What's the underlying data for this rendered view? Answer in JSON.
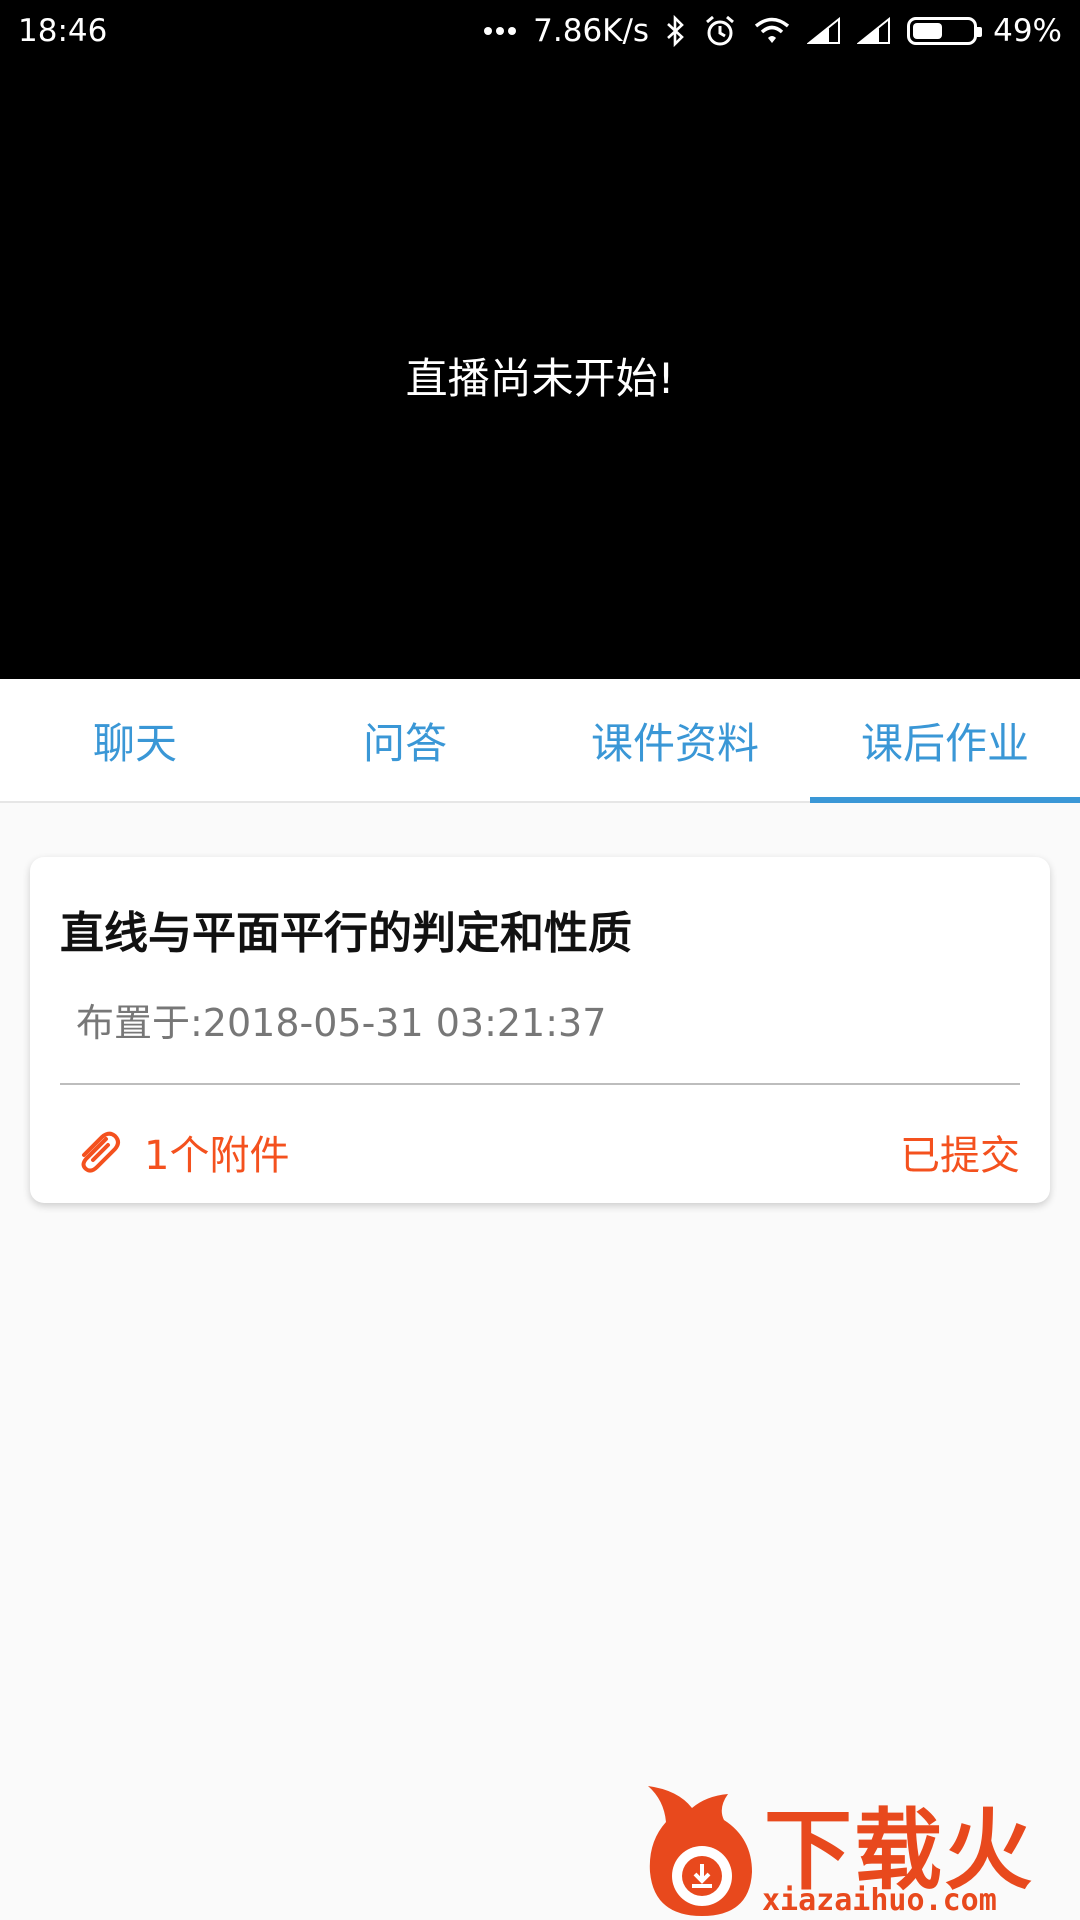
{
  "status_bar": {
    "time": "18:46",
    "network_speed": "7.86K/s",
    "battery_percent": "49%",
    "battery_level": 0.49,
    "icons": [
      "more-dots-icon",
      "bluetooth-icon",
      "alarm-icon",
      "wifi-icon",
      "signal-icon",
      "signal-icon",
      "battery-icon"
    ]
  },
  "video": {
    "message": "直播尚未开始!"
  },
  "tabs": [
    {
      "label": "聊天",
      "active": false
    },
    {
      "label": "问答",
      "active": false
    },
    {
      "label": "课件资料",
      "active": false
    },
    {
      "label": "课后作业",
      "active": true
    }
  ],
  "homework": {
    "title": "直线与平面平行的判定和性质",
    "assigned": "布置于:2018-05-31 03:21:37",
    "attachments": "1个附件",
    "status": "已提交",
    "accent_color": "#f4511e"
  },
  "watermark": {
    "title": "下载火",
    "url": "xiazaihuo.com"
  },
  "colors": {
    "tab_blue": "#3a97d6",
    "video_bg": "#000000",
    "page_bg": "#fafafa"
  }
}
